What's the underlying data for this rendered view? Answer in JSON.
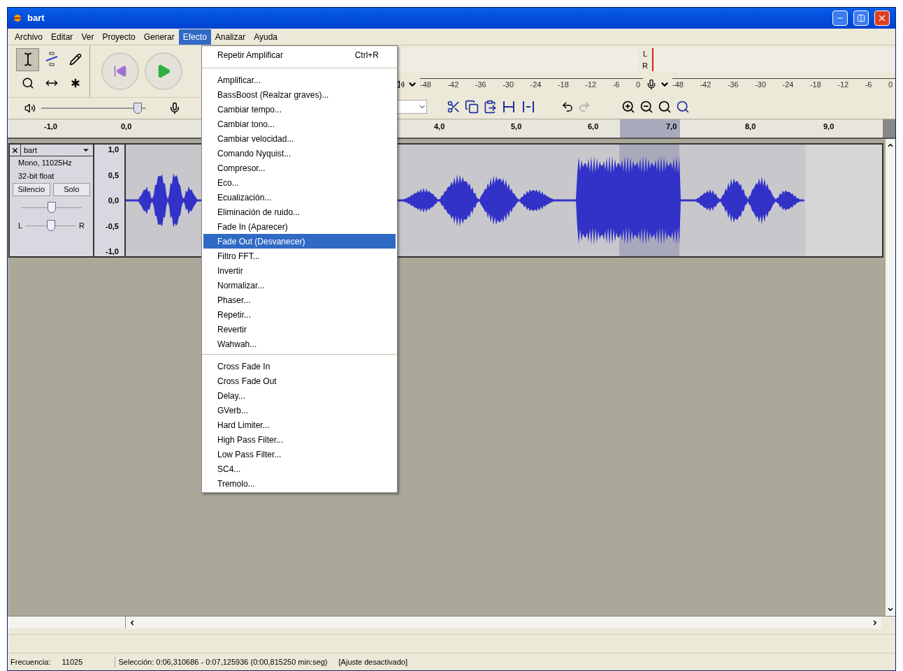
{
  "window": {
    "title": "bart"
  },
  "menu_bar": [
    {
      "label": "Archivo",
      "selected": false
    },
    {
      "label": "Editar",
      "selected": false
    },
    {
      "label": "Ver",
      "selected": false
    },
    {
      "label": "Proyecto",
      "selected": false
    },
    {
      "label": "Generar",
      "selected": false
    },
    {
      "label": "Efecto",
      "selected": true
    },
    {
      "label": "Analizar",
      "selected": false
    },
    {
      "label": "Ayuda",
      "selected": false
    }
  ],
  "mixer": {
    "output_volume": {
      "level": 0.92
    }
  },
  "meters": {
    "left_label": "L",
    "right_label": "R",
    "playback_scale": [
      "-48",
      "-42",
      "-36",
      "-30",
      "-24",
      "-18",
      "-12",
      "-6",
      "0"
    ],
    "record_scale": [
      "-48",
      "-42",
      "-36",
      "-30",
      "-24",
      "-18",
      "-12",
      "-6",
      "0"
    ]
  },
  "ruler": {
    "labels": [
      "-1,0",
      "0,0",
      "4,0",
      "5,0",
      "6,0",
      "7,0",
      "8,0",
      "9,0"
    ]
  },
  "track": {
    "name": "bart",
    "info": [
      "Mono, 11025Hz",
      "32-bit float"
    ],
    "buttons": [
      "Silencio",
      "Solo"
    ],
    "gain": {
      "level": 0.5
    },
    "pan": {
      "level": 0.5,
      "left": "L",
      "right": "R"
    },
    "scale": [
      "1,0",
      "0,5",
      "0,0",
      "-0,5",
      "-1,0"
    ]
  },
  "effect_menu": {
    "groups": [
      [
        {
          "label": "Repetir Amplificar",
          "shortcut": "Ctrl+R",
          "selected": false
        }
      ],
      [
        {
          "label": "Amplificar...",
          "selected": false
        },
        {
          "label": "BassBoost (Realzar graves)...",
          "selected": false
        },
        {
          "label": "Cambiar tempo...",
          "selected": false
        },
        {
          "label": "Cambiar tono...",
          "selected": false
        },
        {
          "label": "Cambiar velocidad...",
          "selected": false
        },
        {
          "label": "Comando Nyquist...",
          "selected": false
        },
        {
          "label": "Compresor...",
          "selected": false
        },
        {
          "label": "Eco...",
          "selected": false
        },
        {
          "label": "Ecualización...",
          "selected": false
        },
        {
          "label": "Eliminación de ruido...",
          "selected": false
        },
        {
          "label": "Fade In (Aparecer)",
          "selected": false
        },
        {
          "label": "Fade Out (Desvanecer)",
          "selected": true
        },
        {
          "label": "Filtro FFT...",
          "selected": false
        },
        {
          "label": "Invertir",
          "selected": false
        },
        {
          "label": "Normalizar...",
          "selected": false
        },
        {
          "label": "Phaser...",
          "selected": false
        },
        {
          "label": "Repetir...",
          "selected": false
        },
        {
          "label": "Revertir",
          "selected": false
        },
        {
          "label": "Wahwah...",
          "selected": false
        }
      ],
      [
        {
          "label": "Cross Fade In",
          "selected": false
        },
        {
          "label": "Cross Fade Out",
          "selected": false
        },
        {
          "label": "Delay...",
          "selected": false
        },
        {
          "label": "GVerb...",
          "selected": false
        },
        {
          "label": "Hard Limiter...",
          "selected": false
        },
        {
          "label": "High Pass Filter...",
          "selected": false
        },
        {
          "label": "Low Pass Filter...",
          "selected": false
        },
        {
          "label": "SC4...",
          "selected": false
        },
        {
          "label": "Tremolo...",
          "selected": false
        }
      ]
    ]
  },
  "status_bar": {
    "rate_label": "Frecuencia:",
    "rate": "11025",
    "selection": "Selección: 0:06,310686 - 0:07,125936 (0:00,815250 min:seg)",
    "snap": "[Ajuste desactivado]"
  }
}
